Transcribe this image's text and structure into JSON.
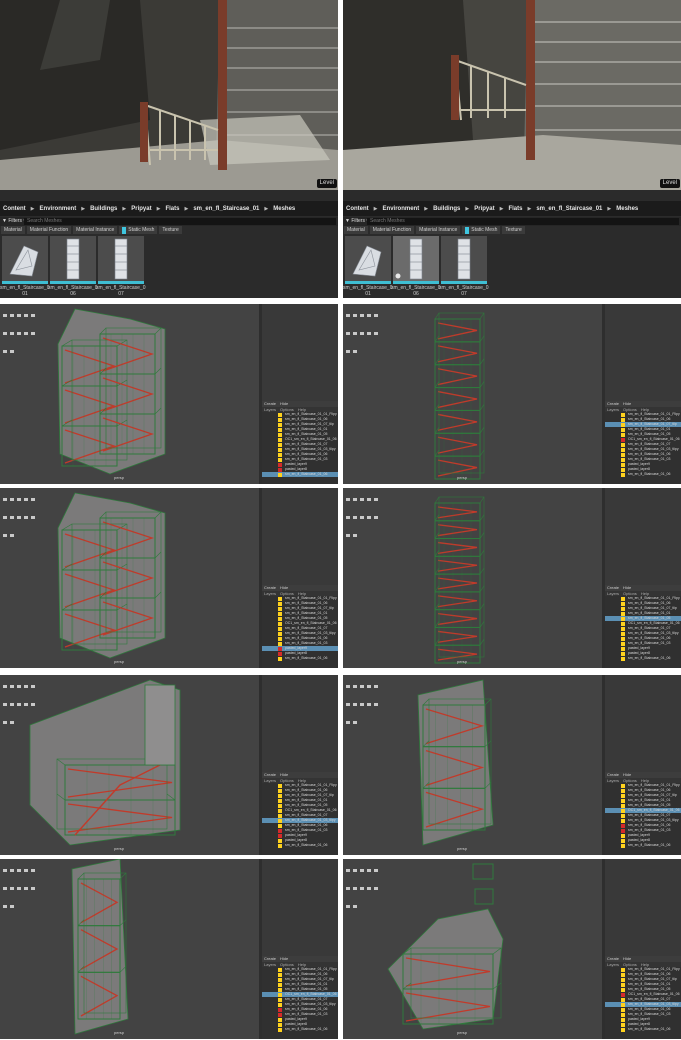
{
  "unreal": {
    "level_button": "Level",
    "breadcrumb": [
      "Content",
      "Environment",
      "Buildings",
      "Pripyat",
      "Flats",
      "sm_en_fl_Staircase_01",
      "Meshes"
    ],
    "filters_label": "▼ Filters ▾",
    "search_placeholder": "Search Meshes",
    "type_filters": [
      "Material",
      "Material Function",
      "Material Instance",
      "Static Mesh",
      "Texture"
    ],
    "assets": [
      {
        "line1": "sm_en_fl_Staircase_01_",
        "line2": "01"
      },
      {
        "line1": "sm_en_fl_Staircase_01_",
        "line2": "06"
      },
      {
        "line1": "sm_en_fl_Staircase_01_",
        "line2": "07"
      }
    ],
    "left_selected_index": -1,
    "right_selected_index": 1,
    "accent_color": "#3fbed3"
  },
  "scene_explorer": {
    "tabs": [
      "Create",
      "Hide"
    ],
    "menu": [
      "Layers",
      "Options",
      "Help"
    ],
    "item_names": [
      "sm_en_fl_Staircase_01_01_Flipy",
      "sm_en_fl_Staircase_01_06",
      "sm_en_fl_Staircase_01_07_tlip",
      "sm_en_fl_Staircase_01_01",
      "sm_en_fl_Staircase_01_05",
      "OC1_sm_en_fl_Staircase_01_06",
      "sm_en_fl_Staircase_01_07",
      "sm_en_fl_Staircase_01_03_tlipy",
      "sm_en_fl_Staircase_01_06",
      "sm_en_fl_Staircase_01_03",
      "pasted_layer9",
      "pasted_layer8",
      "sm_en_fl_Staircase_01_06"
    ]
  },
  "viewport_label": "persp",
  "wire_colors": {
    "structure": "#2f7a3c",
    "stairs": "#c23a2a"
  }
}
